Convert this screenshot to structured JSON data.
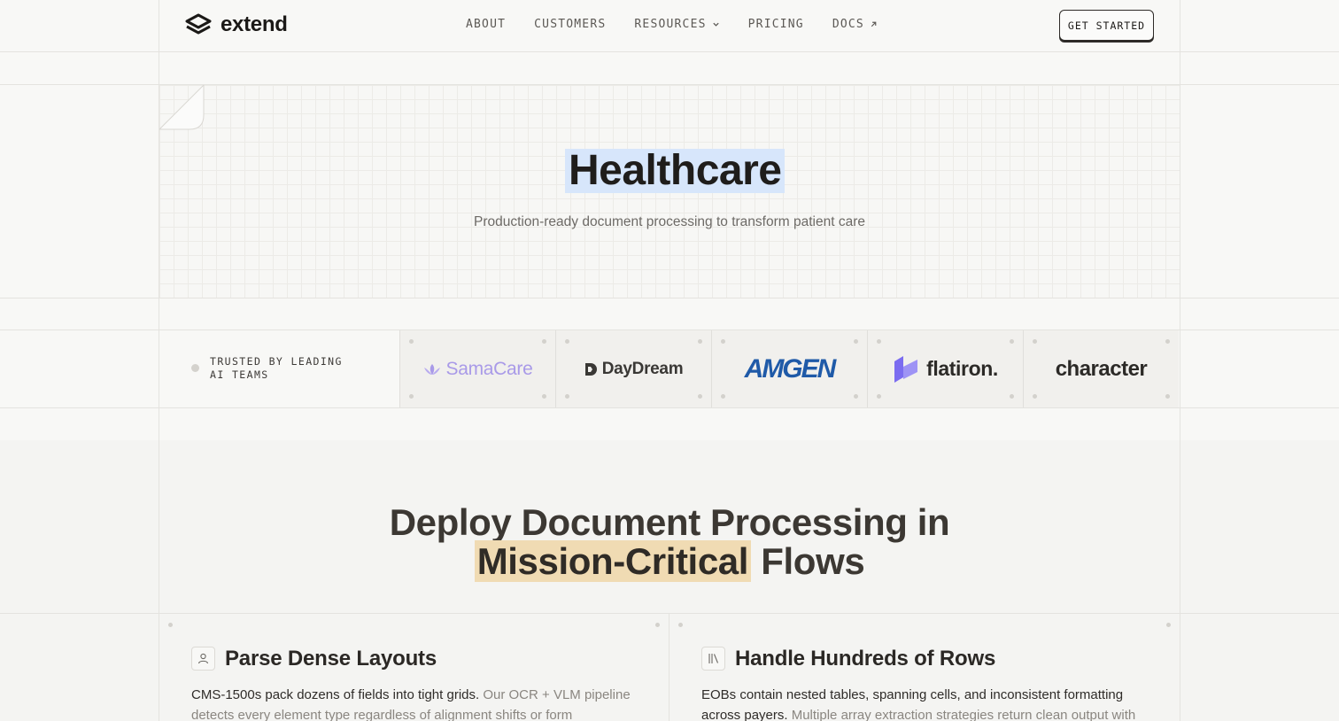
{
  "brand": {
    "name": "extend"
  },
  "nav": {
    "links": [
      {
        "label": "ABOUT"
      },
      {
        "label": "CUSTOMERS"
      },
      {
        "label": "RESOURCES"
      },
      {
        "label": "PRICING"
      },
      {
        "label": "DOCS"
      }
    ],
    "cta_label": "GET STARTED"
  },
  "hero": {
    "title": "Healthcare",
    "subtitle": "Production-ready document processing to transform patient care"
  },
  "trusted": {
    "label": "TRUSTED BY LEADING\nAI TEAMS",
    "logos": [
      "SamaCare",
      "DayDream",
      "AMGEN",
      "flatiron.",
      "character"
    ]
  },
  "deploy": {
    "line1": "Deploy Document Processing in",
    "highlight": "Mission-Critical",
    "line2_rest": " Flows"
  },
  "cards": [
    {
      "title": "Parse Dense Layouts",
      "body_main": "CMS-1500s pack dozens of fields into tight grids.",
      "body_muted": " Our OCR + VLM pipeline detects every element type regardless of alignment shifts or form variations."
    },
    {
      "title": "Handle Hundreds of Rows",
      "body_main": "EOBs contain nested tables, spanning cells, and inconsistent formatting across payers.",
      "body_muted": " Multiple array extraction strategies return clean output with"
    }
  ],
  "colors": {
    "hero_highlight": "#d7e6fb",
    "deploy_highlight": "#f0dbb3",
    "samacare": "#a99ae8",
    "amgen": "#1f5aa8",
    "flatiron_mark": "#7b6cf0"
  }
}
